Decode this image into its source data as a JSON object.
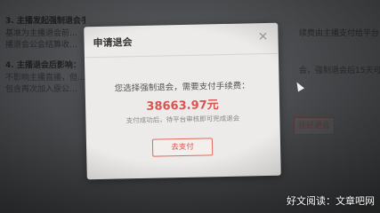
{
  "background": {
    "left_lines": [
      "3. 主播发起强制退会手续费规定：",
      "基准为主播退会前…",
      "播退会公会结算收…",
      "4. 主播退会后影响：",
      "不影响主播直播，但…",
      "包含再次加入原公…"
    ],
    "right_lines": [
      "续费由主播支付给平台，平台",
      "",
      "会，强制退会后15天可再次加",
      ""
    ],
    "button_label": "我好退会"
  },
  "modal": {
    "title": "申请退会",
    "close_glyph": "×",
    "prompt": "您选择强制退会，需要支付手续费：",
    "amount": "38663.97元",
    "note": "支付成功后，待平台审核即可完成退会",
    "pay_button_label": "去支付"
  },
  "watermark": "好文阅读：文章吧网",
  "colors": {
    "amount": "#d9534f",
    "button_border": "#e06a5a"
  }
}
